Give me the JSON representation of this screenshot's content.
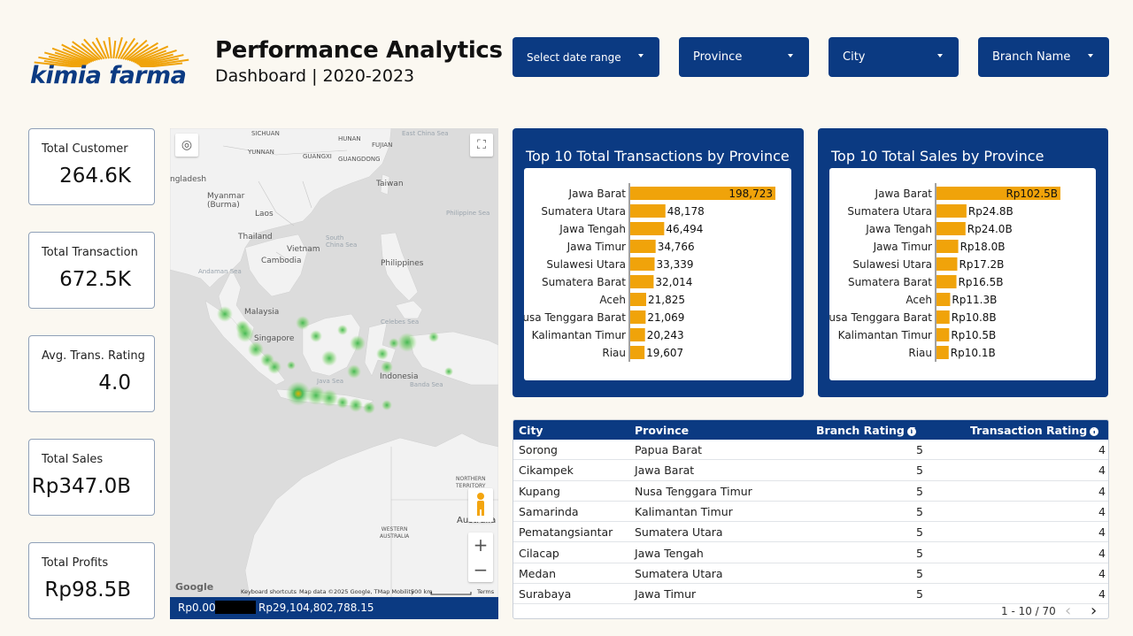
{
  "brand": {
    "logo_text": "kimia farma",
    "accent": "#f0a30a",
    "primary": "#0b3a82"
  },
  "header": {
    "title": "Performance Analytics",
    "subtitle": "Dashboard | 2020-2023"
  },
  "filters": [
    {
      "label": "Select date range"
    },
    {
      "label": "Province"
    },
    {
      "label": "City"
    },
    {
      "label": "Branch Name"
    }
  ],
  "kpis": [
    {
      "label": "Total Customer",
      "value": "264.6K"
    },
    {
      "label": "Total Transaction",
      "value": "672.5K"
    },
    {
      "label": "Avg. Trans. Rating",
      "value": "4.0"
    },
    {
      "label": "Total Sales",
      "value": "Rp347.0B"
    },
    {
      "label": "Total Profits",
      "value": "Rp98.5B"
    }
  ],
  "map": {
    "labels": {
      "sichuan": "SICHUAN",
      "hunan": "HUNAN",
      "east_china_sea": "East China Sea",
      "yunnan": "YUNNAN",
      "guangxi": "GUANGXI",
      "guangdong": "GUANGDONG",
      "fujian": "FUJIAN",
      "taiwan": "Taiwan",
      "bangladesh": "ngladesh",
      "myanmar": "Myanmar\n(Burma)",
      "laos": "Laos",
      "thailand": "Thailand",
      "vietnam": "Vietnam",
      "cambodia": "Cambodia",
      "philippines": "Philippines",
      "philippine_sea": "Philippine Sea",
      "south_china_sea": "South\nChina Sea",
      "andaman_sea": "Andaman Sea",
      "malaysia": "Malaysia",
      "singapore": "Singapore",
      "indonesia": "Indonesia",
      "java_sea": "Java Sea",
      "banda_sea": "Banda Sea",
      "celebes_sea": "Celebes Sea",
      "northern_territory": "NORTHERN\nTERRITORY",
      "western_australia": "WESTERN\nAUSTRALIA",
      "australia": "Australia"
    },
    "google": "Google",
    "attribution": {
      "shortcuts": "Keyboard shortcuts",
      "data": "Map data ©2025 Google, TMap Mobility",
      "scale": "500 km",
      "terms": "Terms"
    },
    "legend_min": "Rp0.00",
    "legend_max": "Rp29,104,802,788.15"
  },
  "transactions_panel": {
    "title": "Top 10 Total Transactions by Province",
    "bar_color": "#f0a30a",
    "chart_data": {
      "type": "bar",
      "orientation": "horizontal",
      "categories": [
        "Jawa Barat",
        "Sumatera Utara",
        "Jawa Tengah",
        "Jawa Timur",
        "Sulawesi Utara",
        "Sumatera Barat",
        "Aceh",
        "Nusa Tenggara Barat",
        "Kalimantan Timur",
        "Riau"
      ],
      "values": [
        198723,
        48178,
        46494,
        34766,
        33339,
        32014,
        21825,
        21069,
        20243,
        19607
      ],
      "labels": [
        "198,723",
        "48,178",
        "46,494",
        "34,766",
        "33,339",
        "32,014",
        "21,825",
        "21,069",
        "20,243",
        "19,607"
      ],
      "xlim": [
        0,
        198723
      ]
    }
  },
  "sales_panel": {
    "title": "Top 10 Total Sales by Province",
    "bar_color": "#f0a30a",
    "chart_data": {
      "type": "bar",
      "orientation": "horizontal",
      "categories": [
        "Jawa Barat",
        "Sumatera Utara",
        "Jawa Tengah",
        "Jawa Timur",
        "Sulawesi Utara",
        "Sumatera Barat",
        "Aceh",
        "Nusa Tenggara Barat",
        "Kalimantan Timur",
        "Riau"
      ],
      "values": [
        102.5,
        24.8,
        24.0,
        18.0,
        17.2,
        16.5,
        11.3,
        10.8,
        10.5,
        10.1
      ],
      "labels": [
        "Rp102.5B",
        "Rp24.8B",
        "Rp24.0B",
        "Rp18.0B",
        "Rp17.2B",
        "Rp16.5B",
        "Rp11.3B",
        "Rp10.8B",
        "Rp10.5B",
        "Rp10.1B"
      ],
      "xlim": [
        0,
        102.5
      ]
    }
  },
  "table": {
    "columns": {
      "city": "City",
      "province": "Province",
      "branch_rating": "Branch Rating",
      "transaction_rating": "Transaction Rating"
    },
    "rows": [
      [
        "Sorong",
        "Papua Barat",
        "5",
        "4"
      ],
      [
        "Cikampek",
        "Jawa Barat",
        "5",
        "4"
      ],
      [
        "Kupang",
        "Nusa Tenggara Timur",
        "5",
        "4"
      ],
      [
        "Samarinda",
        "Kalimantan Timur",
        "5",
        "4"
      ],
      [
        "Pematangsiantar",
        "Sumatera Utara",
        "5",
        "4"
      ],
      [
        "Cilacap",
        "Jawa Tengah",
        "5",
        "4"
      ],
      [
        "Medan",
        "Sumatera Utara",
        "5",
        "4"
      ],
      [
        "Surabaya",
        "Jawa Timur",
        "5",
        "4"
      ]
    ],
    "pager": "1 - 10 / 70",
    "prev": "‹",
    "next": "›"
  }
}
